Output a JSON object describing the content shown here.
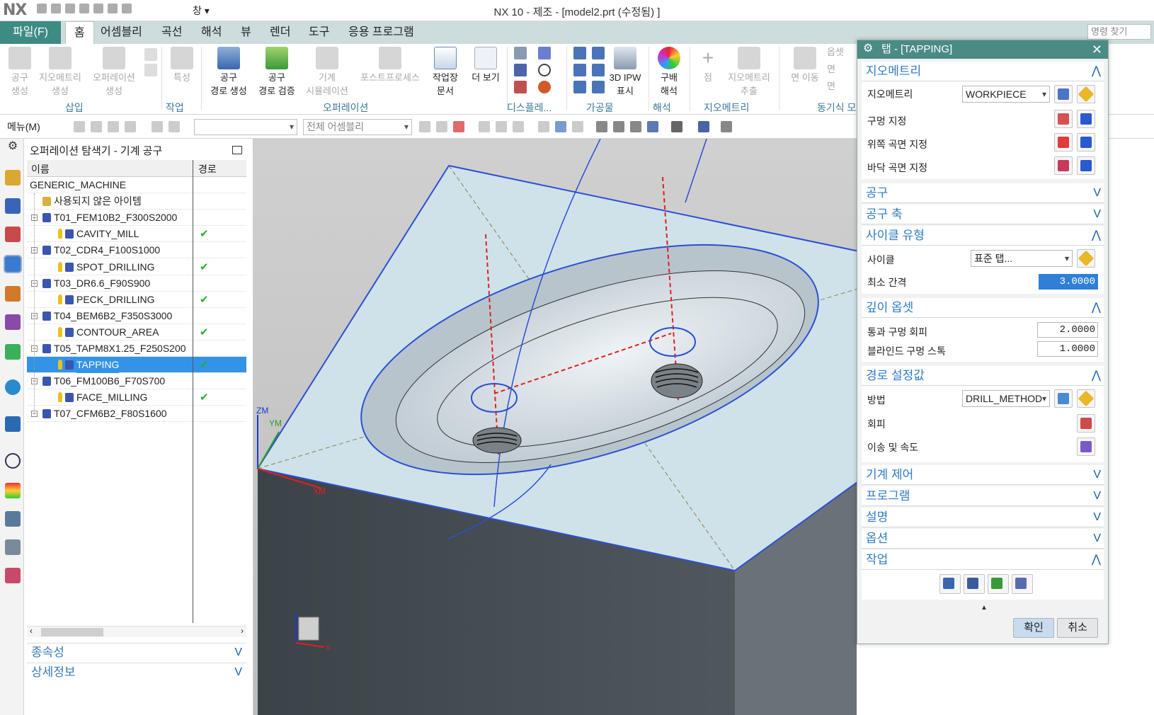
{
  "app": {
    "logo": "NX",
    "title": "NX 10 - 제조 - [model2.prt (수정됨) ]",
    "window_menu": "창 ▾"
  },
  "menubar": {
    "file": "파일(F)",
    "tabs": [
      "홈",
      "어셈블리",
      "곡선",
      "해석",
      "뷰",
      "렌더",
      "도구",
      "응용 프로그램"
    ],
    "search_placeholder": "명령 찾기"
  },
  "ribbon": {
    "buttons": [
      {
        "label": "공구\n생성",
        "enabled": false
      },
      {
        "label": "지오메트리\n생성",
        "enabled": false
      },
      {
        "label": "오퍼레이션\n생성",
        "enabled": false
      },
      {
        "label": "특성",
        "enabled": false
      },
      {
        "label": "공구\n경로 생성",
        "enabled": true
      },
      {
        "label": "공구\n경로 검증",
        "enabled": true
      },
      {
        "label": "기계\n시뮬레이션",
        "enabled": false
      },
      {
        "label": "포스트프로세스",
        "enabled": false
      },
      {
        "label": "작업장\n문서",
        "enabled": true
      },
      {
        "label": "더 보기",
        "enabled": true
      },
      {
        "label": "3D IPW\n표시",
        "enabled": true
      },
      {
        "label": "구배\n해석",
        "enabled": true
      },
      {
        "label": "점",
        "enabled": false
      },
      {
        "label": "지오메트리\n추출",
        "enabled": false
      },
      {
        "label": "면 이동",
        "enabled": false
      }
    ],
    "groups": [
      "삽입",
      "작업",
      "오퍼레이션",
      "디스플레...",
      "가공물",
      "해석",
      "지오메트리",
      "동기식 모"
    ],
    "extra_items": [
      "옵셋",
      "면",
      "면"
    ]
  },
  "toolbar2": {
    "menu": "메뉴(M)",
    "combo1": "",
    "combo2": "전체 어셈블리"
  },
  "navigator": {
    "title": "오퍼레이션 탐색기 - 기계 공구",
    "columns": [
      "이름",
      "경로"
    ],
    "rows": [
      {
        "label": "GENERIC_MACHINE",
        "level": 0,
        "type": "root",
        "check": ""
      },
      {
        "label": "사용되지 않은 아이템",
        "level": 1,
        "type": "folder",
        "check": ""
      },
      {
        "label": "T01_FEM10B2_F300S2000",
        "level": 1,
        "type": "tool",
        "check": ""
      },
      {
        "label": "CAVITY_MILL",
        "level": 2,
        "type": "op",
        "check": "✔"
      },
      {
        "label": "T02_CDR4_F100S1000",
        "level": 1,
        "type": "tool",
        "check": ""
      },
      {
        "label": "SPOT_DRILLING",
        "level": 2,
        "type": "op",
        "check": "✔"
      },
      {
        "label": "T03_DR6.6_F90S900",
        "level": 1,
        "type": "tool",
        "check": ""
      },
      {
        "label": "PECK_DRILLING",
        "level": 2,
        "type": "op",
        "check": "✔"
      },
      {
        "label": "T04_BEM6B2_F350S3000",
        "level": 1,
        "type": "tool",
        "check": ""
      },
      {
        "label": "CONTOUR_AREA",
        "level": 2,
        "type": "op",
        "check": "✔"
      },
      {
        "label": "T05_TAPM8X1.25_F250S200",
        "level": 1,
        "type": "tool",
        "check": ""
      },
      {
        "label": "TAPPING",
        "level": 2,
        "type": "op",
        "check": "✔",
        "selected": true
      },
      {
        "label": "T06_FM100B6_F70S700",
        "level": 1,
        "type": "tool",
        "check": ""
      },
      {
        "label": "FACE_MILLING",
        "level": 2,
        "type": "op",
        "check": "✔"
      },
      {
        "label": "T07_CFM6B2_F80S1600",
        "level": 1,
        "type": "tool",
        "check": ""
      }
    ],
    "sections": [
      "종속성",
      "상세정보"
    ]
  },
  "viewport": {
    "axis_labels": {
      "zm": "ZM",
      "ym": "YM",
      "xm": "XM",
      "z": "Z",
      "x": "X"
    }
  },
  "dialog": {
    "title": "탭 - [TAPPING]",
    "geometry": {
      "header": "지오메트리",
      "geometry_label": "지오메트리",
      "geometry_value": "WORKPIECE",
      "hole_label": "구멍 지정",
      "top_label": "위쪽 곡면 지정",
      "bottom_label": "바닥 곡면 지정"
    },
    "collapsed": {
      "tool": "공구",
      "axis": "공구 축"
    },
    "cycle": {
      "header": "사이클 유형",
      "cycle_label": "사이클",
      "cycle_value": "표준 탭...",
      "clearance_label": "최소 간격",
      "clearance_value": "3.0000"
    },
    "depth": {
      "header": "깊이 옵셋",
      "through_label": "통과 구멍 회피",
      "through_value": "2.0000",
      "blind_label": "블라인드 구멍 스톡",
      "blind_value": "1.0000"
    },
    "path": {
      "header": "경로 설정값",
      "method_label": "방법",
      "method_value": "DRILL_METHOD",
      "avoid_label": "회피",
      "feeds_label": "이송 및 속도"
    },
    "more_sections": [
      "기계 제어",
      "프로그램",
      "설명",
      "옵션"
    ],
    "actions": {
      "header": "작업"
    },
    "ok": "확인",
    "cancel": "취소"
  },
  "colors": {
    "accent": "#4a8b85",
    "file_tab": "#3d8b82",
    "section_text": "#2e7bc4",
    "selection": "#3393e6",
    "check": "#2fa82f",
    "part_top": "#cfe2ea",
    "part_side": "#4a5258",
    "viewport_bg": "#c8c8c8"
  }
}
